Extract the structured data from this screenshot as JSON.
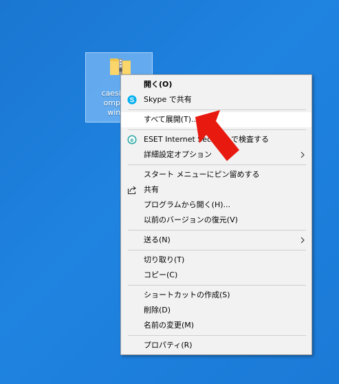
{
  "desktop": {
    "file": {
      "label_lines": [
        "caesium-i",
        "ompress",
        "win-se"
      ]
    }
  },
  "context_menu": {
    "items": [
      {
        "label": "開く(O)",
        "bold": true
      },
      {
        "label": "Skype で共有",
        "icon": "skype-icon"
      },
      {
        "label": "すべて展開(T)..."
      },
      {
        "label": "ESET Internet Security で検査する",
        "icon": "eset-icon"
      },
      {
        "label": "詳細設定オプション",
        "submenu": true
      },
      {
        "label": "スタート メニューにピン留めする"
      },
      {
        "label": "共有",
        "icon": "share-icon"
      },
      {
        "label": "プログラムから開く(H)..."
      },
      {
        "label": "以前のバージョンの復元(V)"
      },
      {
        "label": "送る(N)",
        "submenu": true
      },
      {
        "label": "切り取り(T)"
      },
      {
        "label": "コピー(C)"
      },
      {
        "label": "ショートカットの作成(S)"
      },
      {
        "label": "削除(D)"
      },
      {
        "label": "名前の変更(M)"
      },
      {
        "label": "プロパティ(R)"
      }
    ]
  },
  "colors": {
    "desktop_background": "#1b7ad6",
    "menu_background": "#f2f2f2",
    "highlight_arrow": "#e8190f",
    "skype_blue": "#00aff0",
    "eset_teal": "#23a6a0"
  }
}
